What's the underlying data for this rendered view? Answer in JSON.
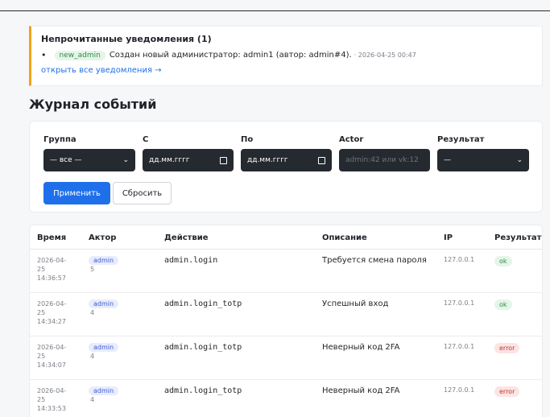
{
  "notifications": {
    "title": "Непрочитанные уведомления (1)",
    "items": [
      {
        "tag": "new_admin",
        "text": "Создан новый администратор: admin1 (автор: admin#4).",
        "date": "· 2026-04-25 00:47"
      }
    ],
    "open_all": "открыть все уведомления →"
  },
  "page_title": "Журнал событий",
  "filters": {
    "group_label": "Группа",
    "group_value": "— все —",
    "from_label": "С",
    "from_value": "дд.мм.гггг",
    "to_label": "По",
    "to_value": "дд.мм.гггг",
    "actor_label": "Actor",
    "actor_placeholder": "admin:42 или vk:12",
    "result_label": "Результат",
    "result_value": "—",
    "apply": "Применить",
    "reset": "Сбросить"
  },
  "table": {
    "headers": [
      "Время",
      "Актор",
      "Действие",
      "Описание",
      "IP",
      "Результат"
    ],
    "rows": [
      {
        "time": [
          "2026-04-",
          "25",
          "14:36:57"
        ],
        "actor": "admin",
        "actor_id": "5",
        "action": "admin.login",
        "desc": "Требуется смена пароля",
        "ip": "127.0.0.1",
        "result": "ok"
      },
      {
        "time": [
          "2026-04-",
          "25",
          "14:34:27"
        ],
        "actor": "admin",
        "actor_id": "4",
        "action": "admin.login_totp",
        "desc": "Успешный вход",
        "ip": "127.0.0.1",
        "result": "ok"
      },
      {
        "time": [
          "2026-04-",
          "25",
          "14:34:07"
        ],
        "actor": "admin",
        "actor_id": "4",
        "action": "admin.login_totp",
        "desc": "Неверный код 2FA",
        "ip": "127.0.0.1",
        "result": "error"
      },
      {
        "time": [
          "2026-04-",
          "25",
          "14:33:53"
        ],
        "actor": "admin",
        "actor_id": "4",
        "action": "admin.login_totp",
        "desc": "Неверный код 2FA",
        "ip": "127.0.0.1",
        "result": "error"
      }
    ]
  },
  "colors": {
    "accent": "#1f6feb",
    "warning_border": "#f0a31a",
    "ok": "#2e8b46",
    "error": "#c2362f"
  }
}
